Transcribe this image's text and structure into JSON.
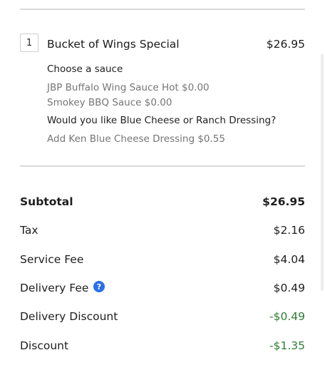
{
  "cart_item": {
    "quantity": "1",
    "name": "Bucket of Wings Special",
    "price": "$26.95",
    "options": [
      {
        "group": "Choose a sauce",
        "values": [
          "JBP Buffalo Wing Sauce Hot $0.00",
          "Smokey BBQ Sauce $0.00"
        ]
      },
      {
        "group": "Would you like Blue Cheese or Ranch Dressing?",
        "values": [
          "Add Ken Blue Cheese Dressing $0.55"
        ]
      }
    ]
  },
  "summary": {
    "subtotal": {
      "label": "Subtotal",
      "value": "$26.95"
    },
    "tax": {
      "label": "Tax",
      "value": "$2.16"
    },
    "service_fee": {
      "label": "Service Fee",
      "value": "$4.04"
    },
    "delivery_fee": {
      "label": "Delivery Fee",
      "value": "$0.49",
      "help_icon": "question-circle-icon"
    },
    "delivery_discount": {
      "label": "Delivery Discount",
      "value": "-$0.49"
    },
    "discount": {
      "label": "Discount",
      "value": "-$1.35"
    }
  },
  "colors": {
    "discount_green": "#2e7d32",
    "help_icon_blue": "#2b6ee8",
    "muted_text": "#757575"
  }
}
